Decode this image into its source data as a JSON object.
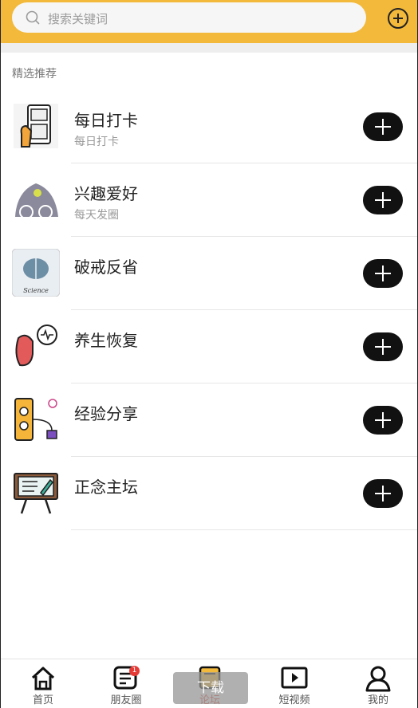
{
  "search": {
    "placeholder": "搜索关键词"
  },
  "section": {
    "label": "精选推荐"
  },
  "items": [
    {
      "title": "每日打卡",
      "subtitle": "每日打卡"
    },
    {
      "title": "兴趣爱好",
      "subtitle": "每天发圈"
    },
    {
      "title": "破戒反省",
      "subtitle": ""
    },
    {
      "title": "养生恢复",
      "subtitle": ""
    },
    {
      "title": "经验分享",
      "subtitle": ""
    },
    {
      "title": "正念主坛",
      "subtitle": ""
    }
  ],
  "thumb_text": {
    "science": "Science"
  },
  "nav": {
    "tabs": [
      {
        "label": "首页",
        "icon": "home-icon"
      },
      {
        "label": "朋友圈",
        "icon": "message-icon",
        "badge": "1"
      },
      {
        "label": "论坛",
        "icon": "forum-icon"
      },
      {
        "label": "短视频",
        "icon": "video-icon"
      },
      {
        "label": "我的",
        "icon": "user-icon"
      }
    ],
    "toast": "下载"
  },
  "colors": {
    "header": "#f3b93a",
    "active": "#e74c3c"
  }
}
